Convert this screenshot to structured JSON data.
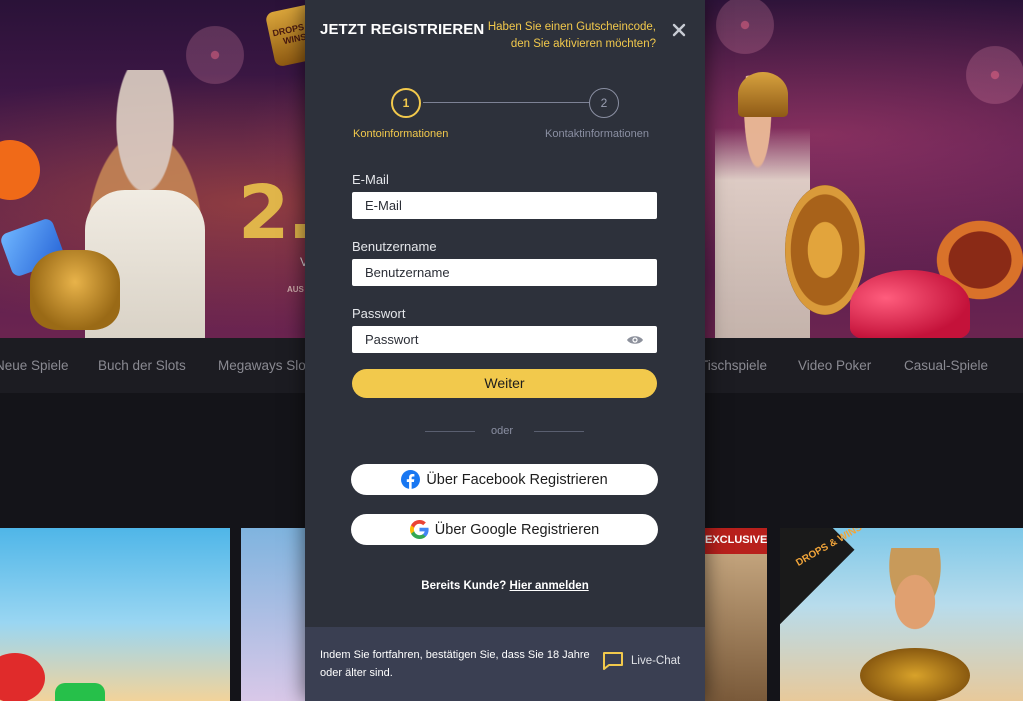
{
  "background": {
    "banner": {
      "logo_text": "DROPS & WINS",
      "headline_fragment": "2.",
      "small_text": "V",
      "small_text2": "AUS DER"
    },
    "nav": [
      "Neue Spiele",
      "Buch der Slots",
      "Megaways Slo",
      "Tischspiele",
      "Video Poker",
      "Casual-Spiele"
    ],
    "tiles": {
      "exclusive_label": "EXCLUSIVE",
      "drops_badge": "DROPS & WINS"
    }
  },
  "modal": {
    "title": "JETZT REGISTRIEREN",
    "voucher_text": "Haben Sie einen Gutscheincode, den Sie aktivieren möchten?",
    "close_icon": "close-icon",
    "steps": [
      {
        "number": "1",
        "label": "Kontoinformationen",
        "active": true
      },
      {
        "number": "2",
        "label": "Kontaktinformationen",
        "active": false
      }
    ],
    "fields": {
      "email": {
        "label": "E-Mail",
        "placeholder": "E-Mail"
      },
      "username": {
        "label": "Benutzername",
        "placeholder": "Benutzername"
      },
      "password": {
        "label": "Passwort",
        "placeholder": "Passwort",
        "toggle_icon": "eye-icon"
      }
    },
    "continue_label": "Weiter",
    "or_label": "oder",
    "facebook_label": "Über Facebook Registrieren",
    "google_label": "Über Google Registrieren",
    "existing_customer": "Bereits Kunde?",
    "login_link": "Hier anmelden",
    "footer": {
      "disclaimer": "Indem Sie fortfahren, bestätigen Sie, dass Sie 18 Jahre oder älter sind.",
      "livechat_label": "Live-Chat",
      "livechat_icon": "chat-bubble-icon"
    }
  },
  "colors": {
    "accent": "#f2c94c",
    "modal_bg": "#2d313b",
    "footer_bg": "#3a3f52",
    "facebook": "#1877f2"
  }
}
